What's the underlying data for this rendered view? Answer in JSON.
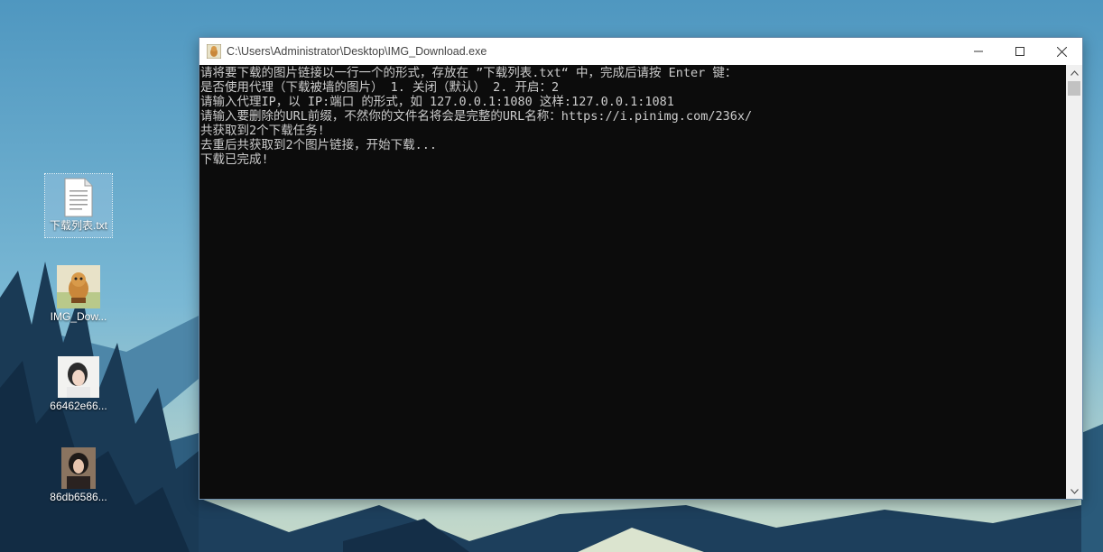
{
  "desktop": {
    "icons": [
      {
        "label": "下载列表.txt",
        "icon": "text-file-icon"
      },
      {
        "label": "IMG_Dow...",
        "icon": "exe-app-icon"
      },
      {
        "label": "66462e66...",
        "icon": "image-thumbnail-icon"
      },
      {
        "label": "86db6586...",
        "icon": "image-thumbnail-icon"
      }
    ]
  },
  "window": {
    "title": "C:\\Users\\Administrator\\Desktop\\IMG_Download.exe",
    "icon": "exe-app-icon",
    "controls": [
      "minimize-icon",
      "maximize-icon",
      "close-icon"
    ]
  },
  "console": {
    "lines": [
      "请将要下载的图片链接以一行一个的形式，存放在 ”下载列表.txt“ 中，完成后请按 Enter 键：",
      "是否使用代理（下载被墙的图片） 1. 关闭（默认） 2. 开启：2",
      "请输入代理IP，以 IP:端口 的形式，如 127.0.0.1:1080 这样:127.0.0.1:1081",
      "请输入要删除的URL前缀，不然你的文件名将会是完整的URL名称：https://i.pinimg.com/236x/",
      "共获取到2个下载任务!",
      "去重后共获取到2个图片链接，开始下载...",
      "下载已完成!"
    ],
    "colors": {
      "background": "#0c0c0c",
      "text": "#cccccc"
    }
  }
}
